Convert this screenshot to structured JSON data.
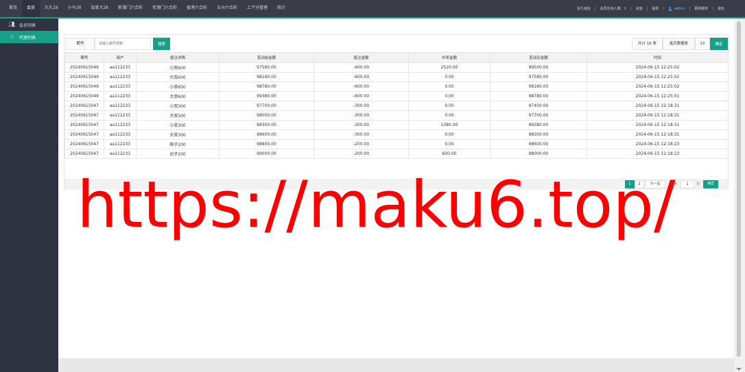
{
  "topnav": [
    {
      "label": "首页",
      "active": false
    },
    {
      "label": "会员",
      "active": true
    },
    {
      "label": "久久28",
      "active": false
    },
    {
      "label": "小马28",
      "active": false
    },
    {
      "label": "加拿大28",
      "active": false
    },
    {
      "label": "新澳门六合彩",
      "active": false
    },
    {
      "label": "老澳门六合彩",
      "active": false
    },
    {
      "label": "香港六合彩",
      "active": false
    },
    {
      "label": "五分六合彩",
      "active": false
    },
    {
      "label": "上下分管理",
      "active": false
    },
    {
      "label": "统计",
      "active": false
    }
  ],
  "topright": {
    "item1": "永久域名",
    "online": "会员在线人数：1",
    "item3": "充值",
    "item4": "提现",
    "admin": "admin",
    "item6": "更新缓存",
    "logout": "退出"
  },
  "sidebar": [
    {
      "label": "会员列表",
      "icon": "users-icon",
      "active": false
    },
    {
      "label": "代理列表",
      "icon": "star-icon",
      "active": true
    }
  ],
  "toolbar": {
    "field_label": "期号",
    "search_placeholder": "请输入期号搜索",
    "search_button": "搜索",
    "total": "共计 16 条",
    "per_page_label": "每页数据条",
    "per_page_value": "10",
    "confirm_button": "确定"
  },
  "table": {
    "headers": [
      "期号",
      "用户",
      "投注详情",
      "变动前金额",
      "投注金额",
      "中奖金额",
      "变动后金额",
      "时间"
    ],
    "rows": [
      [
        "20240615049",
        "aa112233",
        "小双600",
        "97580.00",
        "-600.00",
        "2520.00",
        "99500.00",
        "2024-06-15 12:25:02"
      ],
      [
        "20240615049",
        "aa112233",
        "大双600",
        "98180.00",
        "-600.00",
        "0.00",
        "97580.00",
        "2024-06-15 12:25:02"
      ],
      [
        "20240615049",
        "aa112233",
        "小单600",
        "98780.00",
        "-600.00",
        "0.00",
        "98180.00",
        "2024-06-15 12:25:02"
      ],
      [
        "20240615049",
        "aa112233",
        "大单600",
        "99380.00",
        "-600.00",
        "0.00",
        "98780.00",
        "2024-06-15 12:25:01"
      ],
      [
        "20240615047",
        "aa112233",
        "小双300",
        "97700.00",
        "-300.00",
        "0.00",
        "97400.00",
        "2024-06-15 12:18:31"
      ],
      [
        "20240615047",
        "aa112233",
        "大双300",
        "98000.00",
        "-300.00",
        "0.00",
        "97700.00",
        "2024-06-15 12:18:31"
      ],
      [
        "20240615047",
        "aa112233",
        "小单300",
        "98300.00",
        "-300.00",
        "1380.00",
        "99380.00",
        "2024-06-15 12:18:31"
      ],
      [
        "20240615047",
        "aa112233",
        "大单300",
        "98600.00",
        "-300.00",
        "0.00",
        "98300.00",
        "2024-06-15 12:18:31"
      ],
      [
        "20240615047",
        "aa112233",
        "顺子200",
        "98800.00",
        "-200.00",
        "0.00",
        "98600.00",
        "2024-06-15 12:18:23"
      ],
      [
        "20240615047",
        "aa112233",
        "对子200",
        "99000.00",
        "-200.00",
        "600.00",
        "98000.00",
        "2024-06-15 12:18:23"
      ]
    ]
  },
  "pager": {
    "page1": "1",
    "page2": "2",
    "next": "下一页",
    "goto_label": "到第",
    "goto_value": "1",
    "page_unit": "页",
    "go_button": "确定"
  },
  "watermark": "https://maku6.top/",
  "colors": {
    "accent": "#16a085",
    "topbar": "#393d49",
    "sidebar": "#2f3341",
    "watermark": "#ff0000"
  }
}
